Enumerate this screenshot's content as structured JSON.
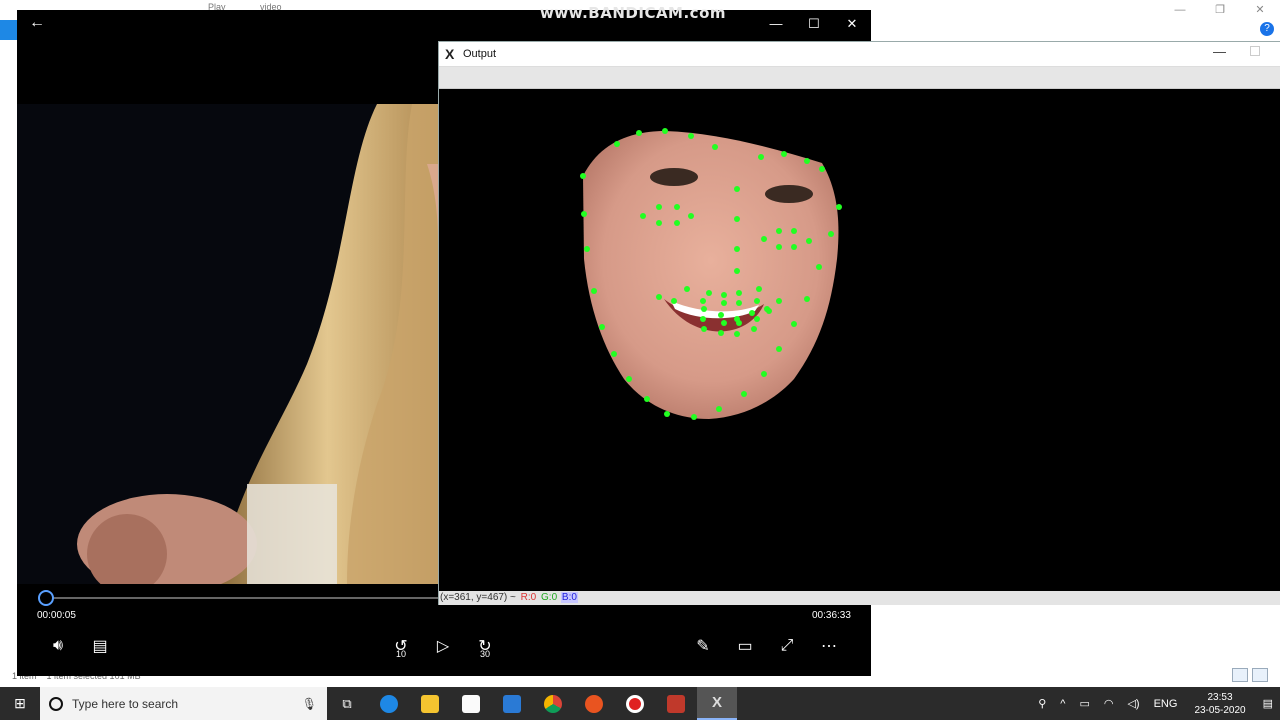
{
  "explorer": {
    "ribbon_tabs": [
      "Play",
      "video"
    ],
    "status_items": "1 item",
    "status_selected": "1 item selected  101 MB"
  },
  "player": {
    "watermark": "www.BANDICAM.com",
    "time_current": "00:00:05",
    "time_total": "00:36:33",
    "skip_back_label": "10",
    "skip_forward_label": "30"
  },
  "output": {
    "title": "Output",
    "status_coords": "(x=361, y=467) ~",
    "status_r": "R:0",
    "status_g": "G:0",
    "status_b": "B:0"
  },
  "taskbar": {
    "search_placeholder": "Type here to search",
    "lang": "ENG",
    "time": "23:53",
    "date": "23-05-2020"
  },
  "colors": {
    "landmark": "#22ff22",
    "taskbar": "#2b2b2b",
    "accent": "#5aa0ff"
  }
}
